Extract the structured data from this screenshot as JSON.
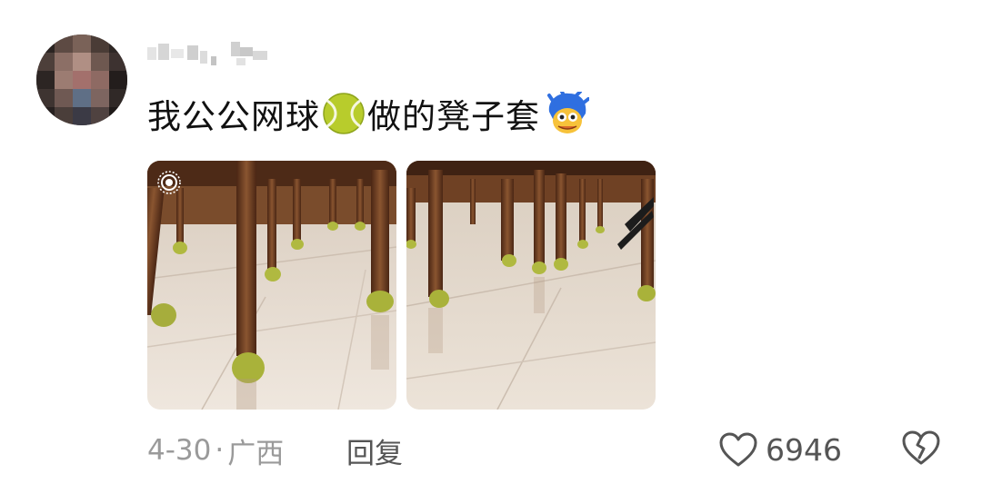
{
  "comment": {
    "text_part1": "我公公网球",
    "text_part2": "做的凳子套",
    "emoji_1": "tennis-ball-emoji",
    "emoji_2": "blue-hair-face-emoji",
    "date": "4-30",
    "separator": "·",
    "location": "广西",
    "reply_label": "回复",
    "like_count": "6946"
  },
  "colors": {
    "text": "#111111",
    "meta": "#9a9a9a",
    "action": "#555555",
    "tennis_ball": "#b5c42a",
    "wood": "#6b3a1f",
    "floor": "#e8ddd2"
  }
}
